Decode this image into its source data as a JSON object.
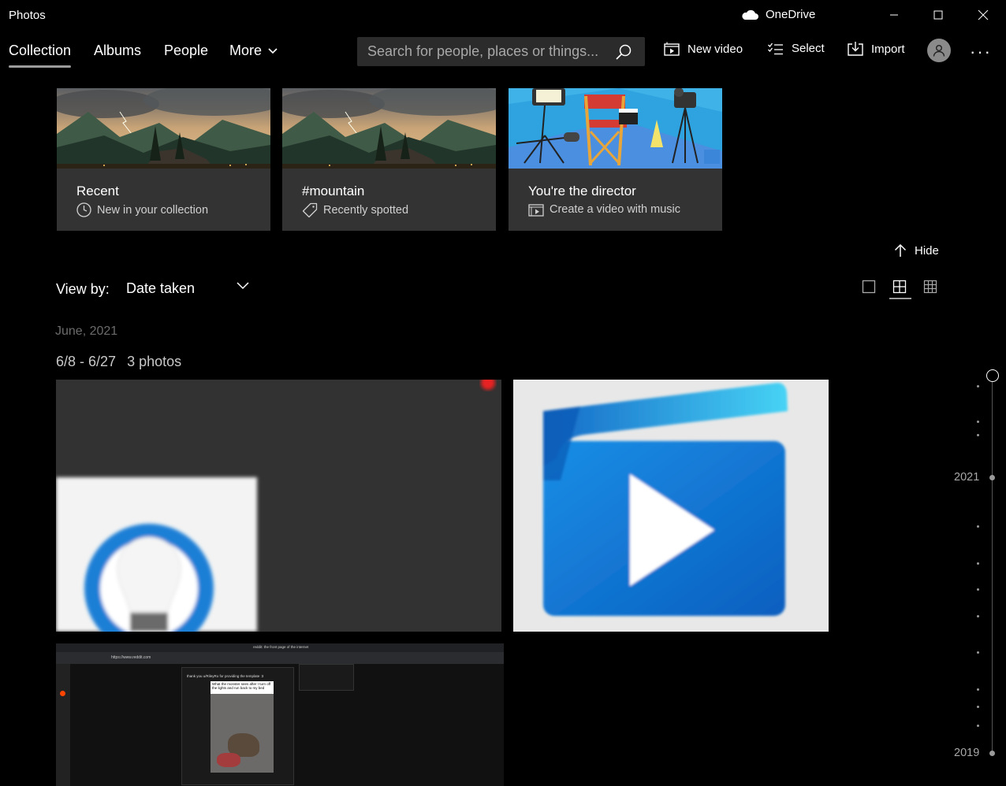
{
  "window": {
    "title": "Photos",
    "onedrive_label": "OneDrive"
  },
  "nav": {
    "tabs": [
      {
        "label": "Collection",
        "active": true
      },
      {
        "label": "Albums"
      },
      {
        "label": "People"
      },
      {
        "label": "More"
      }
    ],
    "search_placeholder": "Search for people, places or things...",
    "new_video_label": "New video",
    "select_label": "Select",
    "import_label": "Import"
  },
  "cards": [
    {
      "title": "Recent",
      "subtitle": "New in your collection",
      "icon": "clock-icon"
    },
    {
      "title": "#mountain",
      "subtitle": "Recently spotted",
      "icon": "tag-icon"
    },
    {
      "title": "You're the director",
      "subtitle": "Create a video with music",
      "icon": "video-icon"
    }
  ],
  "hide_label": "Hide",
  "view_by": {
    "label": "View by:",
    "selected": "Date taken"
  },
  "group": {
    "month": "June, 2021",
    "range": "6/8 - 6/27",
    "count": "3 photos"
  },
  "screenshot_snippet": {
    "url": "https://www.reddit.com",
    "tab_title": "reddit: the front page of the internet",
    "post_line": "thank you u/RileyRo for providing the template :3",
    "caption": "What the monster sees after I turn off the lights and run back to my bed"
  },
  "timeline": {
    "years": [
      "2021",
      "2019"
    ]
  },
  "colors": {
    "background": "#000000",
    "card": "#333333",
    "search": "#2b2b2b",
    "accent_blue": "#1e7fd6"
  }
}
